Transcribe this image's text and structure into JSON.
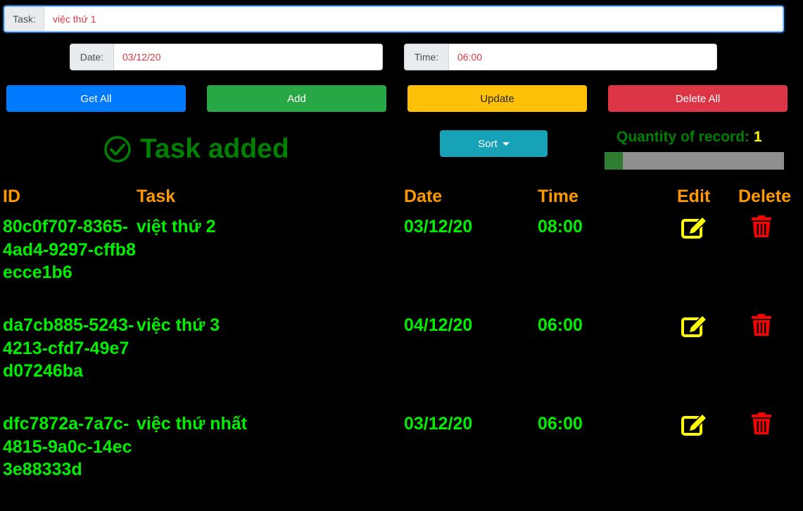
{
  "form": {
    "task": {
      "label": "Task:",
      "value": "việc thứ 1"
    },
    "date": {
      "label": "Date:",
      "value": "03/12/20"
    },
    "time": {
      "label": "Time:",
      "value": "06:00"
    }
  },
  "buttons": {
    "get_all": "Get All",
    "add": "Add",
    "update": "Update",
    "delete_all": "Delete All",
    "sort": "Sort"
  },
  "status_message": "Task added",
  "quantity": {
    "label": "Quantity of record:",
    "count": "1",
    "progress_fraction": 0.1
  },
  "table": {
    "headers": {
      "id": "ID",
      "task": "Task",
      "date": "Date",
      "time": "Time",
      "edit": "Edit",
      "delete": "Delete"
    },
    "rows": [
      {
        "id": "80c0f707-8365-4ad4-9297-cffb8ecce1b6",
        "task": "việt thứ 2",
        "date": "03/12/20",
        "time": "08:00"
      },
      {
        "id": "da7cb885-5243-4213-cfd7-49e7d07246ba",
        "task": "việc thứ 3",
        "date": "04/12/20",
        "time": "06:00"
      },
      {
        "id": "dfc7872a-7a7c-4815-9a0c-14ec3e88333d",
        "task": "việc thứ nhất",
        "date": "03/12/20",
        "time": "06:00"
      }
    ]
  },
  "colors": {
    "primary": "#007bff",
    "success": "#28a745",
    "warning": "#ffc107",
    "danger": "#dc3545",
    "info": "#17a2b8",
    "row_text": "#00ee00",
    "header_text": "#ff9900",
    "edit_icon": "#ffff00",
    "delete_icon": "#ff0000"
  },
  "icons": {
    "status": "check-circle-icon",
    "sort": "caret-down-icon",
    "edit": "edit-square-icon",
    "delete": "trash-icon"
  }
}
